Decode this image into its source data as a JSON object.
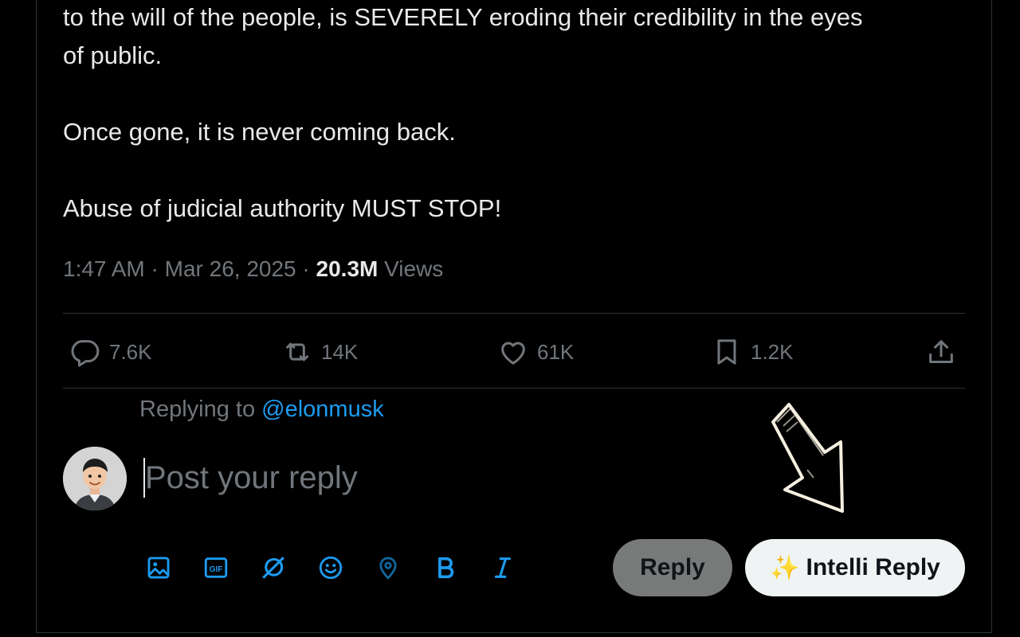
{
  "post": {
    "lines": [
      "to the will of the people, is SEVERELY eroding their credibility in the eyes",
      "of public.",
      "Once gone, it is never coming back.",
      "Abuse of judicial authority MUST STOP!"
    ],
    "time": "1:47 AM",
    "date": "Mar 26, 2025",
    "views_count": "20.3M",
    "views_label": "Views"
  },
  "actions": {
    "replies": "7.6K",
    "reposts": "14K",
    "likes": "61K",
    "bookmarks": "1.2K"
  },
  "reply": {
    "replying_to_label": "Replying to",
    "replying_to_handle": "@elonmusk",
    "placeholder": "Post your reply",
    "reply_button": "Reply",
    "intelli_sparkle": "✨",
    "intelli_button": "Intelli Reply"
  },
  "toolbar": {
    "icons": [
      "image-icon",
      "gif-icon",
      "grok-icon",
      "emoji-icon",
      "location-icon",
      "bold-icon",
      "italic-icon"
    ]
  },
  "colors": {
    "accent": "#1d9bf0",
    "muted": "#71767b",
    "text": "#e7e9ea",
    "background": "#000000"
  }
}
